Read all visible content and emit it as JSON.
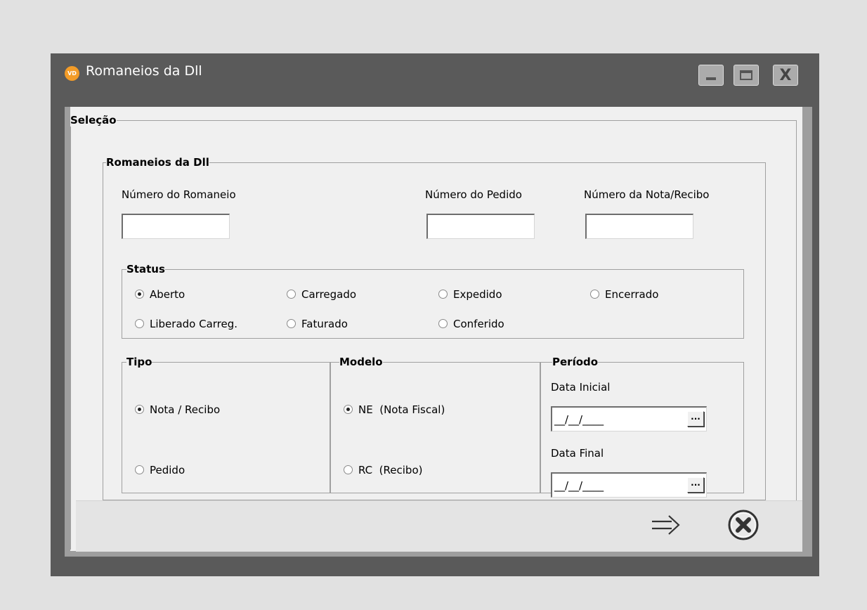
{
  "window": {
    "title": "Romaneios da Dll",
    "icon_text": "VD",
    "close_glyph": "X"
  },
  "selecao": {
    "legend": "Seleção"
  },
  "romaneios": {
    "legend": "Romaneios da Dll",
    "numero_romaneio_label": "Número do Romaneio",
    "numero_romaneio_value": "",
    "numero_pedido_label": "Número do Pedido",
    "numero_pedido_value": "",
    "numero_nota_label": "Número da Nota/Recibo",
    "numero_nota_value": ""
  },
  "status": {
    "legend": "Status",
    "options": [
      {
        "label": "Aberto",
        "checked": true
      },
      {
        "label": "Carregado",
        "checked": false
      },
      {
        "label": "Expedido",
        "checked": false
      },
      {
        "label": "Encerrado",
        "checked": false
      },
      {
        "label": "Liberado Carreg.",
        "checked": false
      },
      {
        "label": "Faturado",
        "checked": false
      },
      {
        "label": "Conferido",
        "checked": false
      }
    ]
  },
  "tipo": {
    "legend": "Tipo",
    "options": [
      {
        "label": "Nota / Recibo",
        "checked": true
      },
      {
        "label": "Pedido",
        "checked": false
      }
    ]
  },
  "modelo": {
    "legend": "Modelo",
    "options": [
      {
        "label": "NE  (Nota Fiscal)",
        "checked": true
      },
      {
        "label": "RC  (Recibo)",
        "checked": false
      }
    ]
  },
  "periodo": {
    "legend": "Período",
    "data_inicial_label": "Data Inicial",
    "data_inicial_mask": "__/__/____",
    "data_final_label": "Data Final",
    "data_final_mask": "__/__/____",
    "picker_label": "..."
  },
  "colors": {
    "titlebar": "#5a5a5a",
    "background": "#f0f0f0",
    "app_icon": "#f39c28"
  }
}
